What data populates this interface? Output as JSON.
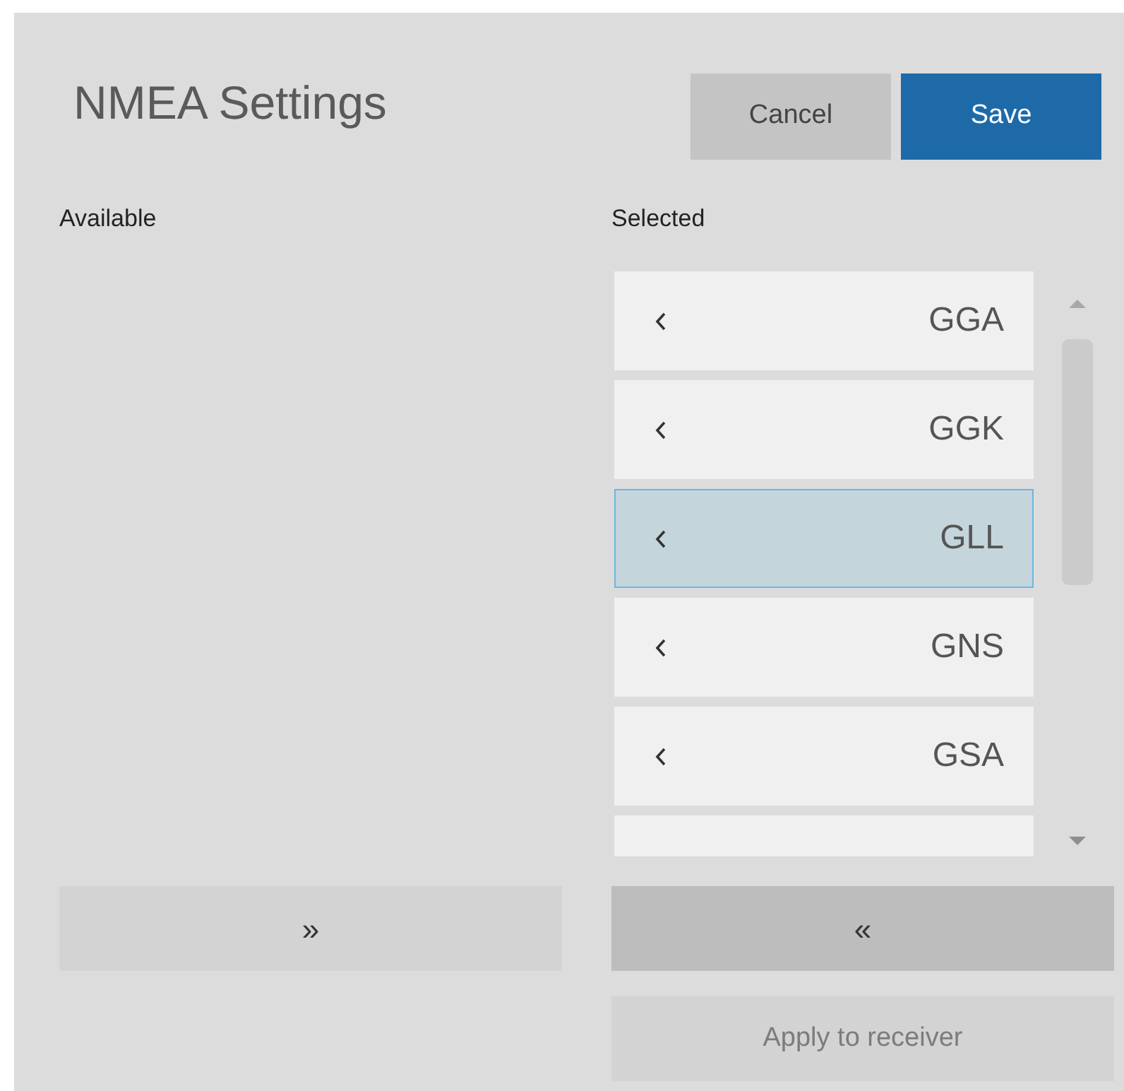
{
  "title": "NMEA Settings",
  "header_buttons": [
    {
      "label": "Cancel",
      "kind": "secondary"
    },
    {
      "label": "Save",
      "kind": "primary"
    }
  ],
  "available": {
    "heading": "Available",
    "move_button": {
      "label": "»",
      "disabled": false
    }
  },
  "selected": {
    "heading": "Selected",
    "items": [
      {
        "label": "GGA",
        "selected": false
      },
      {
        "label": "GGK",
        "selected": false
      },
      {
        "label": "GLL",
        "selected": true
      },
      {
        "label": "GNS",
        "selected": false
      },
      {
        "label": "GSA",
        "selected": false
      },
      {
        "selected": false
      }
    ],
    "move_button": {
      "label": "«",
      "disabled": false
    }
  },
  "apply_button": {
    "label": "Apply to receiver",
    "disabled": true
  }
}
